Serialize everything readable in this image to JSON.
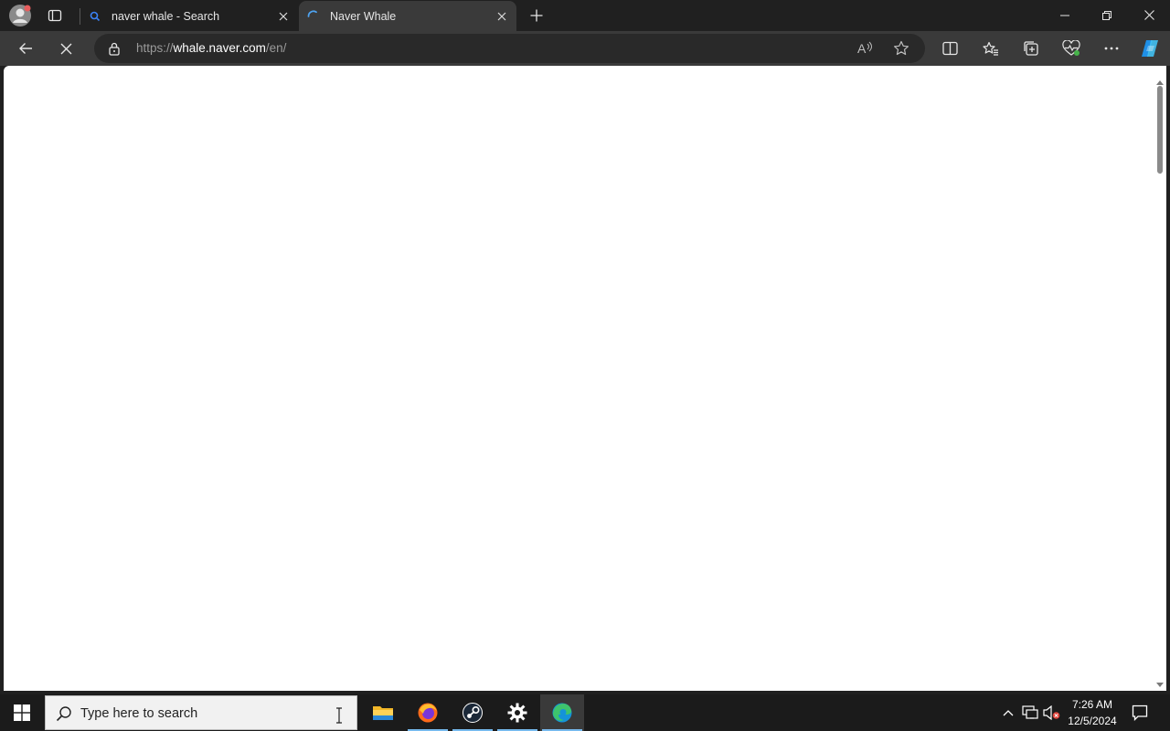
{
  "browser": {
    "tabs": [
      {
        "title": "naver whale - Search",
        "favicon": "search-icon",
        "active": false
      },
      {
        "title": "Naver Whale",
        "favicon": "loading-spinner-icon",
        "active": true
      }
    ],
    "address": {
      "scheme": "https://",
      "host": "whale.naver.com",
      "path": "/en/"
    },
    "colors": {
      "accent": "#3b82f6",
      "frame": "#202020",
      "toolbar": "#3a3a3a"
    }
  },
  "taskbar": {
    "search_placeholder": "Type here to search",
    "apps": [
      "file-explorer-icon",
      "firefox-icon",
      "steam-icon",
      "settings-icon",
      "edge-icon"
    ],
    "clock": {
      "time": "7:26 AM",
      "date": "12/5/2024"
    }
  }
}
